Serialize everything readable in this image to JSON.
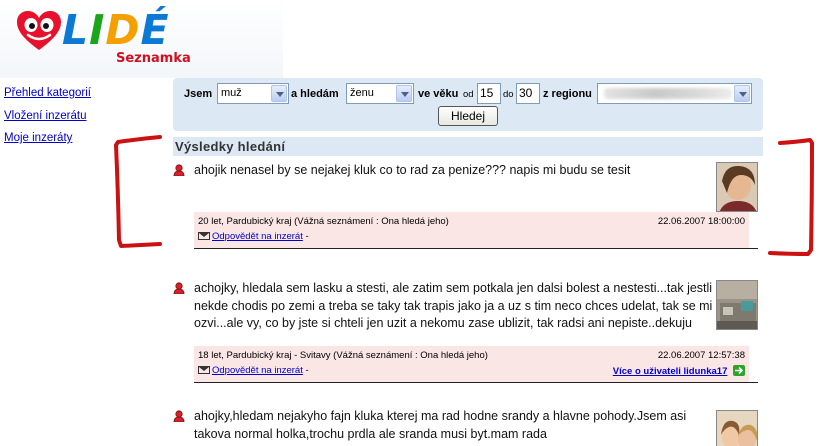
{
  "logo": {
    "text_l": "L",
    "text_i": "I",
    "text_d": "D",
    "text_e": "É",
    "subtitle": "Seznamka"
  },
  "nav": {
    "items": [
      {
        "label": "Přehled kategorií"
      },
      {
        "label": "Vložení inzerátu"
      },
      {
        "label": "Moje inzeráty"
      }
    ]
  },
  "search": {
    "label_jsem": "Jsem",
    "gender_value": "muž",
    "label_hledam": "a hledám",
    "seeking_value": "ženu",
    "label_veku": "ve věku",
    "label_od": "od",
    "age_from": "15",
    "label_do": "do",
    "age_to": "30",
    "label_region": "z regionu",
    "button": "Hledej"
  },
  "results": {
    "heading": "Výsledky hledání",
    "items": [
      {
        "message": "ahojik nenasel by se nejakej kluk co to rad za penize??? napis mi budu se tesit",
        "info": "20 let, Pardubický kraj (Vážná seznámení : Ona hledá jeho)",
        "date": "22.06.2007 18:00:00",
        "reply": "Odpovědět na inzerát",
        "reply_suffix": " -",
        "more": ""
      },
      {
        "message": "achojky, hledala sem lasku a stesti, ale zatim sem potkala jen dalsi bolest a nestesti...tak jestli nekde chodis po zemi a treba se taky tak trapis jako ja a uz s tim neco chces udelat, tak se mi ozvi...ale vy, co by jste si chteli jen uzit a nekomu zase ublizit, tak radsi ani nepiste..dekuju",
        "info": "18 let, Pardubický kraj - Svitavy (Vážná seznámení : Ona hledá jeho)",
        "date": "22.06.2007 12:57:38",
        "reply": "Odpovědět na inzerát",
        "reply_suffix": " -",
        "more": "Více o uživateli lidunka17"
      },
      {
        "message": "ahojky,hledam nejakyho fajn kluka kterej ma rad hodne srandy a hlavne pohody.Jsem asi takova normal holka,trochu prdla ale sranda musi byt.mam rada",
        "info": "",
        "date": "",
        "reply": "",
        "reply_suffix": "",
        "more": ""
      }
    ]
  },
  "colors": {
    "search_bg": "#dde8f5",
    "meta_bg": "#fbe6e6",
    "link": "#0000cc",
    "annotation": "#cc1111"
  }
}
